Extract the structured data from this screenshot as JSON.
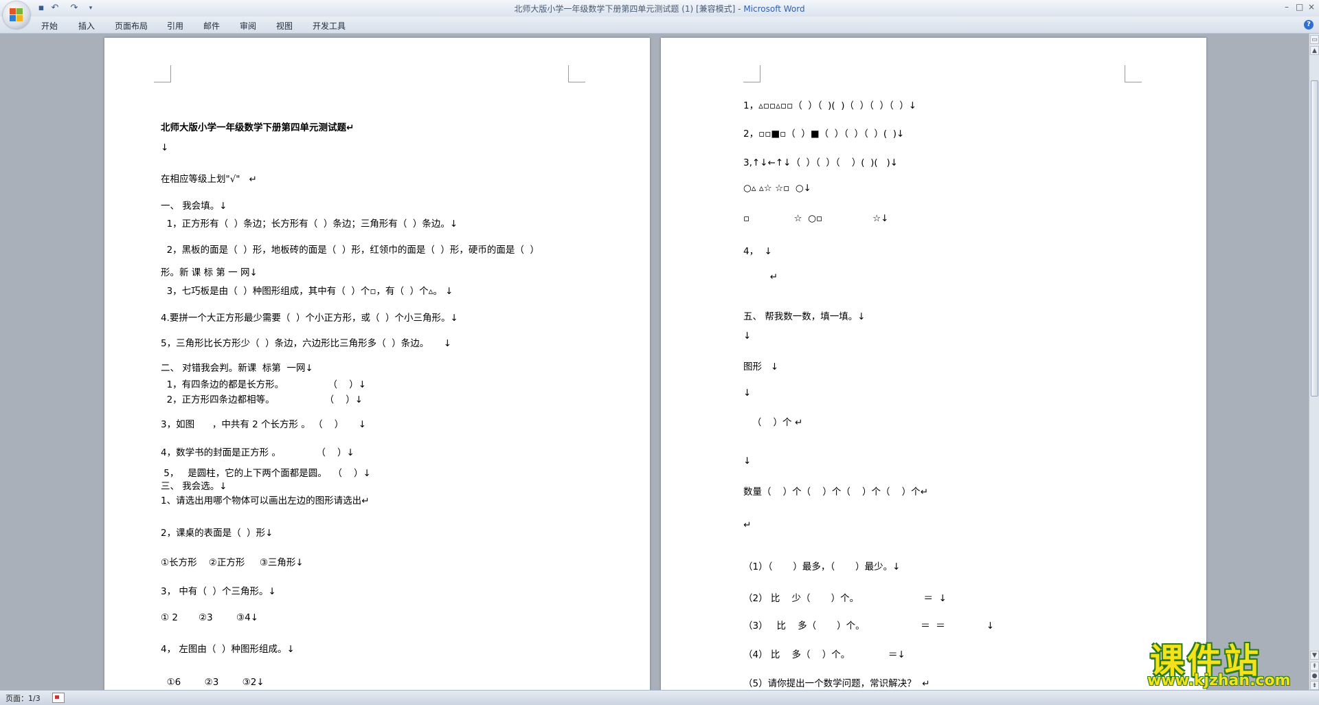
{
  "window": {
    "title_main": "北师大版小学一年级数学下册第四单元测试题 (1) [兼容模式] - ",
    "title_app": "Microsoft Word",
    "minimize": "–",
    "maximize": "□",
    "close": "×"
  },
  "quick_access": {
    "save_icon": "save-icon",
    "undo_icon": "undo-icon",
    "redo_icon": "redo-icon",
    "customize_icon": "dropdown-icon"
  },
  "menu": {
    "items": [
      "开始",
      "插入",
      "页面布局",
      "引用",
      "邮件",
      "审阅",
      "视图",
      "开发工具"
    ]
  },
  "help": "?",
  "page1": {
    "lines": [
      "北师大版小学一年级数学下册第四单元测试题↵",
      "↓",
      "在相应等级上划\"√\"   ↵",
      "一、 我会填。↓",
      "  1，正方形有（  ）条边；长方形有（  ）条边；三角形有（  ）条边。↓",
      "  2，黑板的面是（  ）形，地板砖的面是（  ）形，红领巾的面是（  ）形，硬币的面是（  ）",
      "形。新 课 标 第 一 网↓",
      "  3，七巧板是由（  ）种图形组成，其中有（  ）个▫，有（  ）个▵。 ↓",
      "4.要拼一个大正方形最少需要（  ）个小正方形，或（  ）个小三角形。↓",
      "5，三角形比长方形少（  ）条边，六边形比三角形多（  ）条边。     ↓",
      "二、 对错我会判。新课  标第  一网↓",
      "  1，有四条边的都是长方形。               （    ）↓",
      "  2，正方形四条边都相等。                 （    ）↓",
      "3，如图      ，中共有 2 个长方形 。 （    ）     ↓",
      "4，数学书的封面是正方形 。            （    ）↓",
      " 5，   是圆柱，它的上下两个面都是圆。  （    ）↓",
      "三、 我会选。↓",
      "1、请选出用哪个物体可以画出左边的图形请选出↵",
      "2，课桌的表面是（  ）形↓",
      "①长方形    ②正方形     ③三角形↓",
      "3， 中有（  ）个三角形。↓",
      "① 2       ②3        ③4↓",
      "4， 左图由（  ）种图形组成。↓",
      "  ①6        ②3        ③2↓"
    ]
  },
  "page2": {
    "lines": [
      "1，▵▫▫▵▫▫（  ）（  )(  )（  ）（  ）（  ）↓",
      "2，▫▫■▫（  ）■（  ）（  ）（  ）(  )↓",
      "3,↑↓←↑↓（  ）（  ）（    ）(  )(   )↓",
      "○▵ ▵☆ ☆▫  ○↓",
      "▫               ☆  ○▫                 ☆↓",
      "4，  ↓",
      "         ↵",
      "五、 帮我数一数，填一填。↓",
      "↓",
      "图形   ↓",
      "↓",
      "   （    ）个 ↵",
      "↓",
      "数量（    ）个（    ）个（    ）个（    ）个↵",
      "↵",
      "（1）（       ）最多，（       ）最少。↓",
      "（2） 比    少（       ）个。                      ＝  ↓",
      "（3）   比    多（       ）个。                   ＝  ＝              ↓",
      "（4） 比    多（    ）个。             ＝↓",
      "（5）请你提出一个数学问题，常识解决？  ↵"
    ]
  },
  "status": {
    "page": "页面：1/3"
  },
  "watermark": {
    "title": "课件站",
    "url": "www.kjzhan.com"
  },
  "colors": {
    "accent": "#2f5fb0",
    "workspace": "#a9b0ba",
    "watermark_fill": "#f4e21a",
    "watermark_stroke": "#2a7a1e"
  }
}
